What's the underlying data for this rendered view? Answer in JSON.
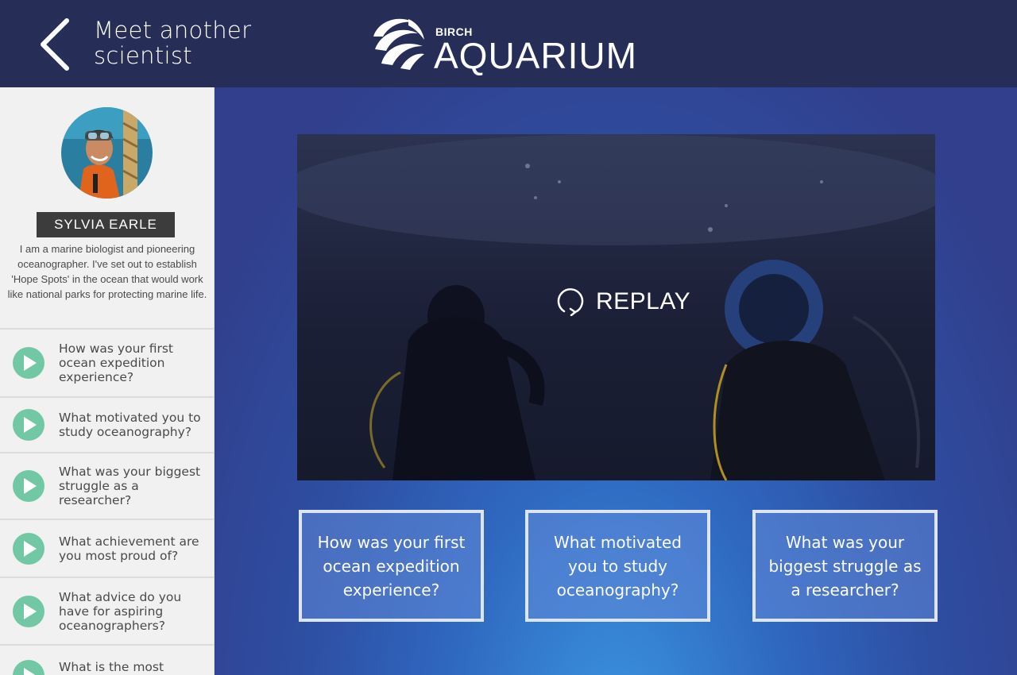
{
  "header": {
    "title_line1": "Meet another",
    "title_line2": "scientist",
    "logo_small": "BIRCH",
    "logo_big": "AQUARIUM"
  },
  "scientist": {
    "name": "SYLVIA EARLE",
    "bio": "I am a marine biologist and pioneering oceanographer. I've set out to establish 'Hope Spots' in the ocean that would work like national parks for protecting marine life."
  },
  "questions": [
    {
      "label": "How was your first ocean expedition experience?"
    },
    {
      "label": "What motivated you to study oceanography?"
    },
    {
      "label": "What was your biggest struggle as a researcher?"
    },
    {
      "label": "What achievement are you most proud of?"
    },
    {
      "label": "What advice do you have for aspiring oceanographers?"
    },
    {
      "label": "What is the most"
    }
  ],
  "video": {
    "replay_label": "REPLAY"
  },
  "cards": [
    {
      "label": "How was your first ocean expedition experience?"
    },
    {
      "label": "What motivated you to study oceanography?"
    },
    {
      "label": "What was your biggest struggle as a researcher?"
    }
  ],
  "colors": {
    "header_bg": "#262e58",
    "sidebar_bg": "#f1f1f1",
    "play_accent": "#72c8a4",
    "name_badge_bg": "#3c3c3c"
  },
  "icons": [
    "back-chevron-icon",
    "play-icon",
    "replay-icon",
    "birch-aquarium-logo"
  ]
}
